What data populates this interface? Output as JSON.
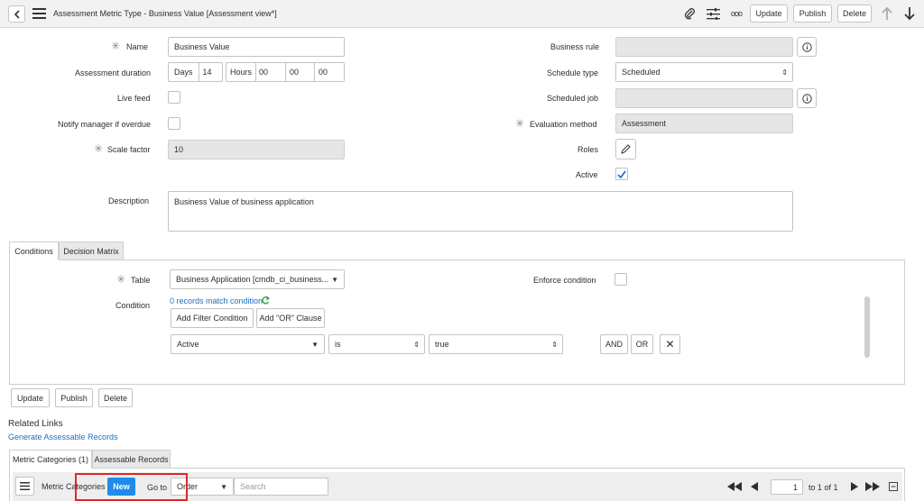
{
  "header": {
    "title": "Assessment Metric Type - Business Value [Assessment view*]",
    "update": "Update",
    "publish": "Publish",
    "delete": "Delete",
    "more": "ooo"
  },
  "form": {
    "name_label": "Name",
    "name_value": "Business Value",
    "duration_label": "Assessment duration",
    "days_label": "Days",
    "days_value": "14",
    "hours_label": "Hours",
    "hours_value": "00",
    "minutes_value": "00",
    "seconds_value": "00",
    "live_feed_label": "Live feed",
    "notify_label": "Notify manager if overdue",
    "scale_label": "Scale factor",
    "scale_value": "10",
    "business_rule_label": "Business rule",
    "schedule_type_label": "Schedule type",
    "schedule_type_value": "Scheduled",
    "scheduled_job_label": "Scheduled job",
    "eval_method_label": "Evaluation method",
    "eval_method_value": "Assessment",
    "roles_label": "Roles",
    "active_label": "Active",
    "description_label": "Description",
    "description_value": "Business Value of business application"
  },
  "tabs": {
    "conditions": "Conditions",
    "decision_matrix": "Decision Matrix"
  },
  "conditions": {
    "table_label": "Table",
    "table_value": "Business Application [cmdb_ci_business...",
    "enforce_label": "Enforce condition",
    "condition_label": "Condition",
    "records_match": "0 records match condition",
    "add_filter": "Add Filter Condition",
    "add_or": "Add \"OR\" Clause",
    "field_value": "Active",
    "operator_value": "is",
    "value_value": "true",
    "and": "AND",
    "or": "OR",
    "remove": "✕"
  },
  "bottom_buttons": {
    "update": "Update",
    "publish": "Publish",
    "delete": "Delete"
  },
  "related_links": {
    "heading": "Related Links",
    "generate": "Generate Assessable Records"
  },
  "related_tabs": {
    "metric_categories": "Metric Categories (1)",
    "assessable_records": "Assessable Records"
  },
  "list_toolbar": {
    "title": "Metric Categories",
    "new": "New",
    "goto": "Go to",
    "goto_field": "Order",
    "search_placeholder": "Search",
    "page_value": "1",
    "page_of": "to 1 of 1"
  },
  "colors": {
    "accent_blue": "#1f8ceb",
    "link_blue": "#1f6fbf",
    "highlight_red": "#e0262b",
    "header_bg": "#f2f2f2"
  }
}
